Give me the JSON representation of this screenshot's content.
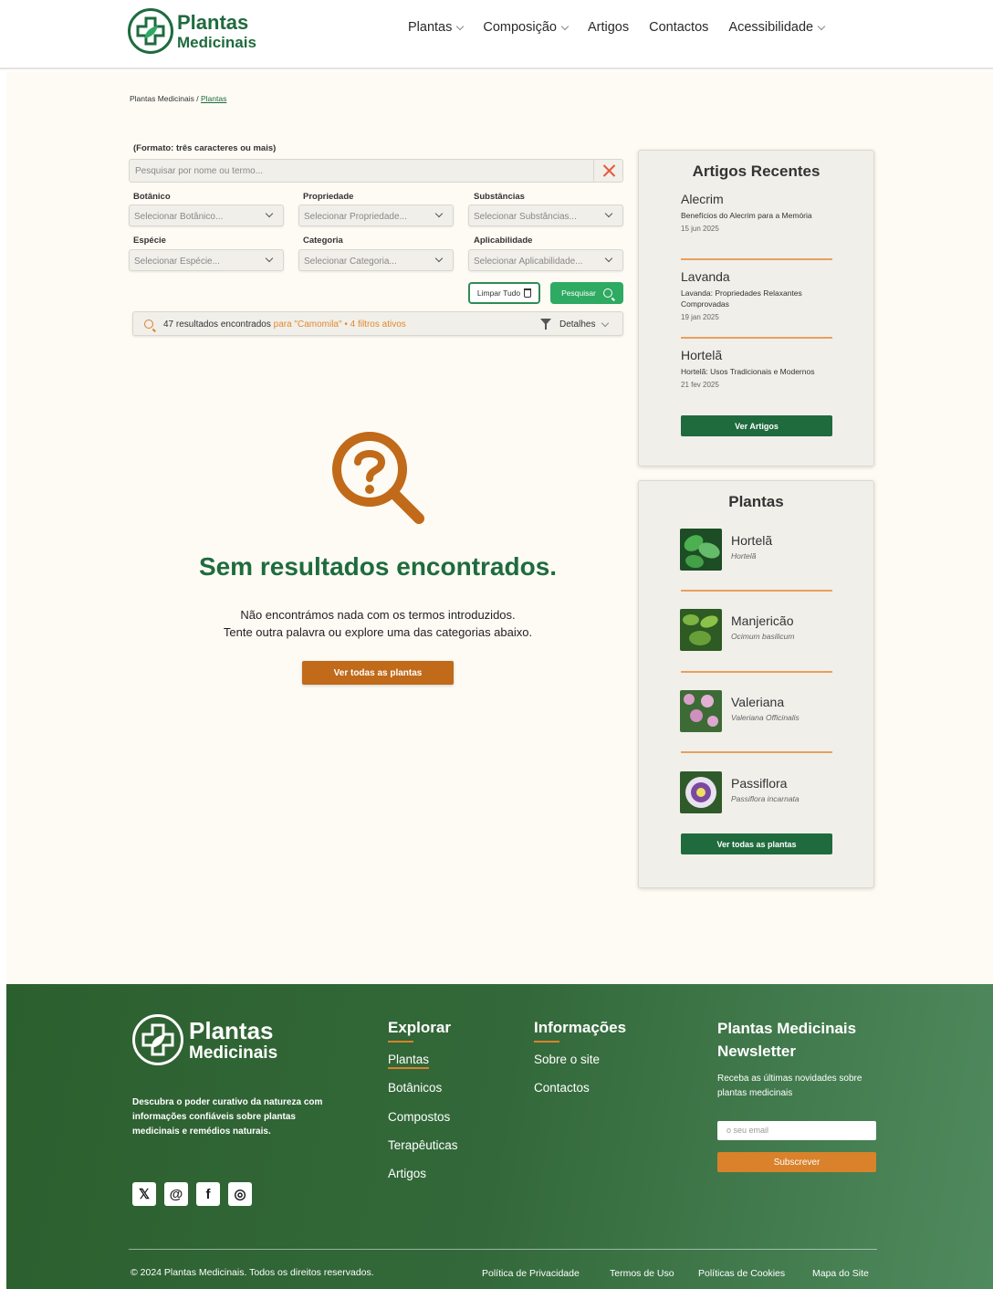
{
  "colors": {
    "primary_green": "#1f6b3e",
    "accent_orange": "#d9822b",
    "search_green": "#2eaa62",
    "background": "#fdfbf4"
  },
  "header": {
    "logo": {
      "line1": "Plantas",
      "line2": "Medicinais"
    },
    "nav": [
      {
        "label": "Plantas",
        "dropdown": true
      },
      {
        "label": "Composição",
        "dropdown": true
      },
      {
        "label": "Artigos",
        "dropdown": false
      },
      {
        "label": "Contactos",
        "dropdown": false
      },
      {
        "label": "Acessibilidade",
        "dropdown": true
      }
    ]
  },
  "breadcrumb": {
    "root": "Plantas Medicinais",
    "sep": "/",
    "current": "Plantas"
  },
  "search": {
    "label": "(Formato: três caracteres ou mais)",
    "placeholder": "Pesquisar por nome ou termo...",
    "clear_icon": "close-icon"
  },
  "filters": [
    {
      "label": "Botânico",
      "placeholder": "Selecionar Botânico..."
    },
    {
      "label": "Propriedade",
      "placeholder": "Selecionar Propriedade..."
    },
    {
      "label": "Substâncias",
      "placeholder": "Selecionar Substâncias..."
    },
    {
      "label": "Espécie",
      "placeholder": "Selecionar Espécie..."
    },
    {
      "label": "Categoria",
      "placeholder": "Selecionar Categoria..."
    },
    {
      "label": "Aplicabilidade",
      "placeholder": "Selecionar Aplicabilidade..."
    }
  ],
  "actions": {
    "clear_label": "Limpar Tudo",
    "search_label": "Pesquisar"
  },
  "results": {
    "count_text": "47 resultados encontrados",
    "query_text": "para \"Camomila\"",
    "bullet": "•",
    "filters_text": "4 filtros ativos",
    "details_label": "Detalhes"
  },
  "no_results": {
    "title": "Sem resultados encontrados.",
    "line1": "Não encontrámos nada com os termos introduzidos.",
    "line2": "Tente outra palavra ou explore uma das categorias abaixo.",
    "button": "Ver todas as plantas",
    "icon": "question-search-icon"
  },
  "recent_articles": {
    "title": "Artigos Recentes",
    "items": [
      {
        "name": "Alecrim",
        "desc": "Benefícios do Alecrim para a Memória",
        "date": "15 jun 2025"
      },
      {
        "name": "Lavanda",
        "desc": "Lavanda: Propriedades Relaxantes Comprovadas",
        "date": "19 jan 2025"
      },
      {
        "name": "Hortelã",
        "desc": "Hortelã: Usos Tradicionais e Modernos",
        "date": "21 fev 2025"
      }
    ],
    "button": "Ver Artigos"
  },
  "plants_card": {
    "title": "Plantas",
    "items": [
      {
        "name": "Hortelã",
        "scientific": "Hortelã"
      },
      {
        "name": "Manjericão",
        "scientific": "Ocimum basilicum"
      },
      {
        "name": "Valeriana",
        "scientific": "Valeriana Officinalis"
      },
      {
        "name": "Passiflora",
        "scientific": "Passiflora incarnata"
      }
    ],
    "button": "Ver todas as plantas"
  },
  "footer": {
    "logo": {
      "line1": "Plantas",
      "line2": "Medicinais"
    },
    "description": "Descubra o poder curativo da natureza com informações confiáveis sobre plantas medicinais e remédios naturais.",
    "social": [
      {
        "name": "x-icon",
        "glyph": "𝕏"
      },
      {
        "name": "threads-icon",
        "glyph": "@"
      },
      {
        "name": "facebook-icon",
        "glyph": "f"
      },
      {
        "name": "instagram-icon",
        "glyph": "◎"
      }
    ],
    "explore": {
      "title": "Explorar",
      "links": [
        "Plantas",
        "Botânicos",
        "Compostos",
        "Terapêuticas",
        "Artigos"
      ]
    },
    "info": {
      "title": "Informações",
      "links": [
        "Sobre o site",
        "Contactos"
      ]
    },
    "newsletter": {
      "title_line1": "Plantas Medicinais",
      "title_line2": "Newsletter",
      "text": "Receba as últimas novidades sobre plantas medicinais",
      "placeholder": "o seu email",
      "button": "Subscrever"
    },
    "copyright": "© 2024 Plantas Medicinais. Todos os direitos reservados.",
    "legal": [
      "Política de Privacidade",
      "Termos de Uso",
      "Políticas de Cookies",
      "Mapa do Site"
    ]
  }
}
